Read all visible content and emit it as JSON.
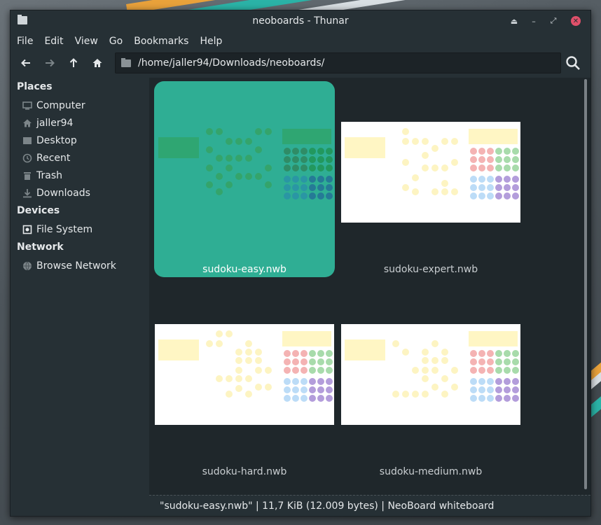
{
  "window": {
    "title": "neoboards - Thunar"
  },
  "menu": [
    "File",
    "Edit",
    "View",
    "Go",
    "Bookmarks",
    "Help"
  ],
  "toolbar": {
    "back_icon": "arrow-left-icon",
    "forward_icon": "arrow-right-icon",
    "up_icon": "arrow-up-icon",
    "home_icon": "home-icon",
    "location": "/home/jaller94/Downloads/neoboards/",
    "search_icon": "search-icon"
  },
  "sidebar": {
    "places_title": "Places",
    "places": [
      {
        "label": "Computer",
        "icon": "monitor-icon"
      },
      {
        "label": "jaller94",
        "icon": "home-icon"
      },
      {
        "label": "Desktop",
        "icon": "desktop-folder-icon"
      },
      {
        "label": "Recent",
        "icon": "clock-icon"
      },
      {
        "label": "Trash",
        "icon": "trash-icon"
      },
      {
        "label": "Downloads",
        "icon": "download-icon"
      }
    ],
    "devices_title": "Devices",
    "devices": [
      {
        "label": "File System",
        "icon": "drive-icon"
      }
    ],
    "network_title": "Network",
    "network": [
      {
        "label": "Browse Network",
        "icon": "globe-icon"
      }
    ]
  },
  "files": [
    {
      "name": "sudoku-easy.nwb",
      "selected": true
    },
    {
      "name": "sudoku-expert.nwb",
      "selected": false
    },
    {
      "name": "sudoku-hard.nwb",
      "selected": false
    },
    {
      "name": "sudoku-medium.nwb",
      "selected": false
    }
  ],
  "status": "\"sudoku-easy.nwb\"  |  11,7 KiB (12.009 bytes)  |  NeoBoard whiteboard",
  "colors": {
    "selection": "#2fae94",
    "note_yellow": "#fff6c4",
    "dot_yellow": "#fdf4c2",
    "red": "#f4b3b3",
    "green": "#a8dbab",
    "blue": "#bcdcf7",
    "purple": "#b39ddb"
  }
}
